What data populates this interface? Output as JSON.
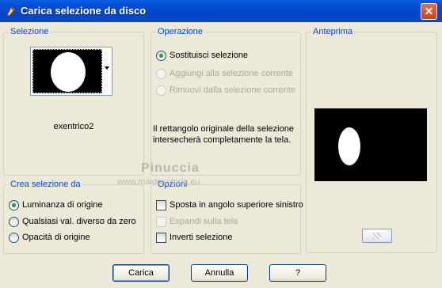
{
  "window": {
    "title": "Carica selezione da disco",
    "close_label": "✕"
  },
  "selezione": {
    "legend": "Selezione",
    "filename": "exentrico2"
  },
  "operazione": {
    "legend": "Operazione",
    "options": [
      {
        "label": "Sostituisci selezione",
        "checked": true,
        "enabled": true
      },
      {
        "label": "Aggiungi alla selezione corrente",
        "checked": false,
        "enabled": false
      },
      {
        "label": "Rimuovi dalla selezione corrente",
        "checked": false,
        "enabled": false
      }
    ],
    "info_line1": "Il rettangolo originale della selezione",
    "info_line2": "intersecherà completamente la tela."
  },
  "anteprima": {
    "legend": "Anteprima"
  },
  "crea": {
    "legend": "Crea selezione da",
    "options": [
      {
        "label": "Luminanza di origine",
        "checked": true
      },
      {
        "label": "Qualsiasi val. diverso da zero",
        "checked": false
      },
      {
        "label": "Opacità di origine",
        "checked": false
      }
    ]
  },
  "opzioni": {
    "legend": "Opzioni",
    "options": [
      {
        "label": "Sposta in angolo superiore sinistro",
        "checked": false,
        "enabled": true
      },
      {
        "label": "Espandi sulla tela",
        "checked": false,
        "enabled": false
      },
      {
        "label": "Inverti selezione",
        "checked": false,
        "enabled": true
      }
    ]
  },
  "watermark": {
    "line1": "Pinuccia",
    "line2": "www.maidosutoria.eu"
  },
  "buttons": {
    "ok": "Carica",
    "cancel": "Annulla",
    "help": "?"
  }
}
